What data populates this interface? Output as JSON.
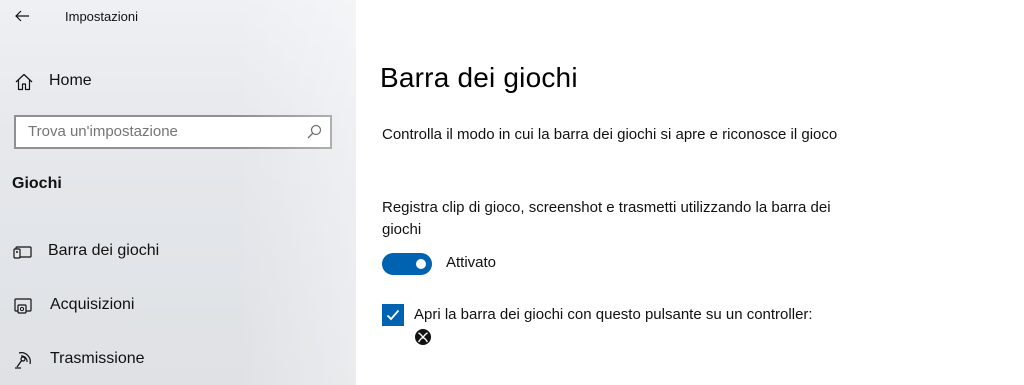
{
  "window": {
    "title": "Impostazioni"
  },
  "sidebar": {
    "home_label": "Home",
    "search_placeholder": "Trova un'impostazione",
    "section_title": "Giochi",
    "items": [
      {
        "label": "Barra dei giochi",
        "icon": "game-bar-icon"
      },
      {
        "label": "Acquisizioni",
        "icon": "captures-icon"
      },
      {
        "label": "Trasmissione",
        "icon": "broadcasting-icon"
      }
    ]
  },
  "main": {
    "title": "Barra dei giochi",
    "description": "Controlla il modo in cui la barra dei giochi si apre e riconosce il gioco",
    "record_setting": {
      "label": "Registra clip di gioco, screenshot e trasmetti utilizzando la barra dei giochi",
      "state_label": "Attivato",
      "on": true
    },
    "controller_option": {
      "label": "Apri la barra dei giochi con questo pulsante su un controller:",
      "checked": true,
      "icon": "xbox-icon"
    }
  },
  "colors": {
    "accent": "#0063b1",
    "sidebar_bg": "#e6e8ec"
  }
}
